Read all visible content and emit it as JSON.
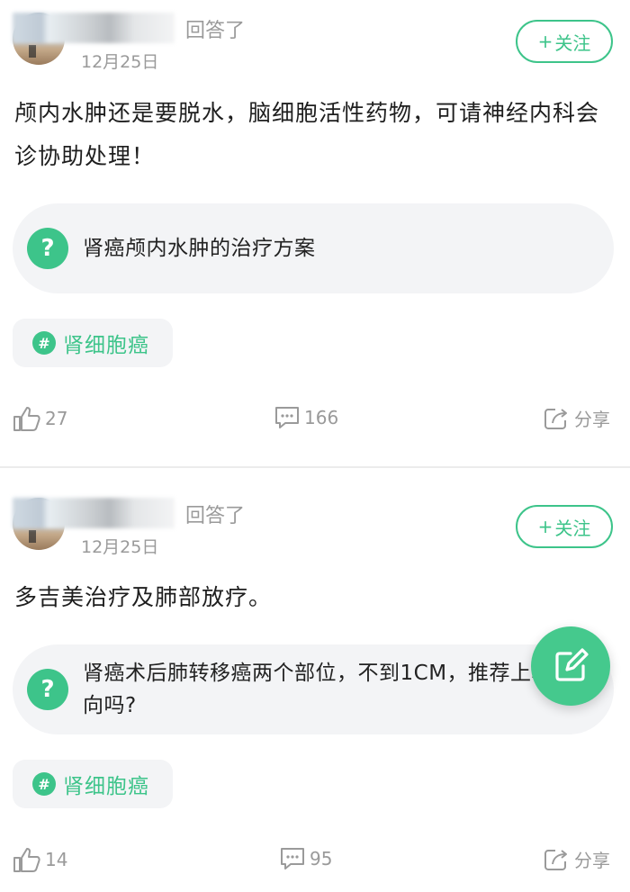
{
  "answers": [
    {
      "answered_label": "回答了",
      "date": "12月25日",
      "follow_label": "关注",
      "text": "颅内水肿还是要脱水，脑细胞活性药物，可请神经内科会诊协助处理！",
      "question": "肾癌颅内水肿的治疗方案",
      "tag": "肾细胞癌",
      "likes": "27",
      "comments": "166",
      "share_label": "分享"
    },
    {
      "answered_label": "回答了",
      "date": "12月25日",
      "follow_label": "关注",
      "text": "多吉美治疗及肺部放疗。",
      "question": "肾癌术后肺转移癌两个部位，不到1CM，推荐上靶向吗?",
      "tag": "肾细胞癌",
      "likes": "14",
      "comments": "95",
      "share_label": "分享"
    }
  ],
  "icons": {
    "question_icon": "question-mark-icon",
    "tag_icon": "hash-icon",
    "like_icon": "thumbs-up-icon",
    "comment_icon": "comment-bubble-icon",
    "share_icon": "share-icon",
    "fab_icon": "edit-pencil-icon",
    "follow_icon": "plus-icon"
  },
  "colors": {
    "accent": "#3dc48a",
    "muted_text": "#9a9a9a",
    "pill_bg": "#f3f4f6"
  }
}
